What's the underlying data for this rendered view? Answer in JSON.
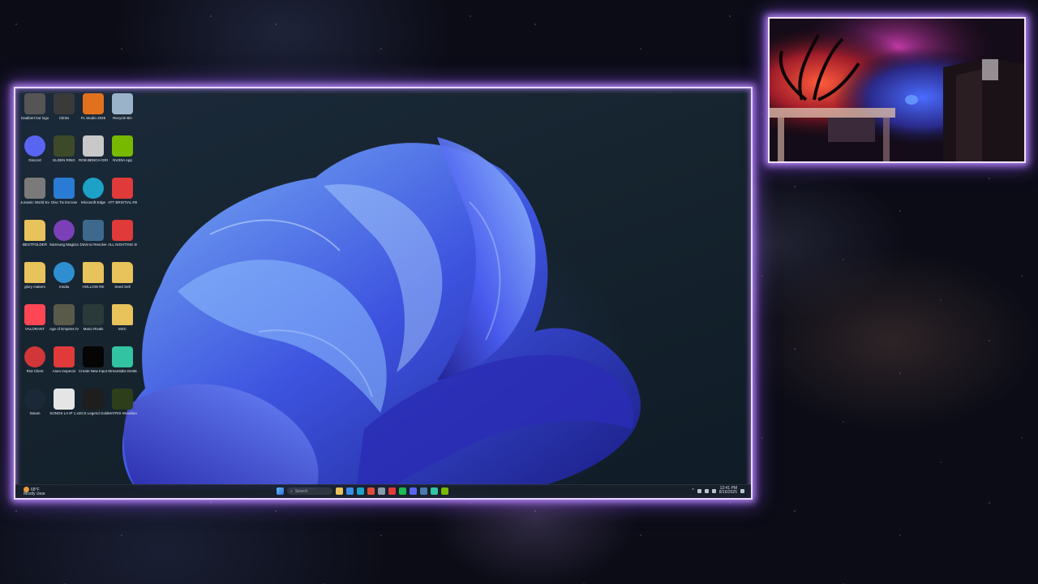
{
  "desktop": {
    "icons": [
      {
        "label": "Gaalbert bot logo",
        "icon": "image-file-icon",
        "color": "#555"
      },
      {
        "label": "Clinks",
        "icon": "app-icon",
        "color": "#3a3a3a"
      },
      {
        "label": "FL Studio 2025",
        "icon": "fl-studio-icon",
        "color": "#e2711d"
      },
      {
        "label": "Recycle Bin",
        "icon": "recycle-bin-icon",
        "color": "#9bb3c9"
      },
      {
        "label": "Discord",
        "icon": "discord-icon",
        "color": "#5865f2"
      },
      {
        "label": "ELDEN RING",
        "icon": "elden-ring-icon",
        "color": "#3d4a2a"
      },
      {
        "label": "RGB BENCH GRID SHEET",
        "icon": "document-icon",
        "color": "#c8c8c8"
      },
      {
        "label": "NVIDIA App",
        "icon": "nvidia-icon",
        "color": "#76b900"
      },
      {
        "label": "Jurassic World Evolution",
        "icon": "jurassic-icon",
        "color": "#7a7a7a"
      },
      {
        "label": "Disc Tix Escrow",
        "icon": "disc-icon",
        "color": "#2a7bd4"
      },
      {
        "label": "Microsoft Edge",
        "icon": "edge-icon",
        "color": "#1da1c7"
      },
      {
        "label": "ATT BRISTIAL RE SHEED",
        "icon": "pdf-icon",
        "color": "#e03a3a"
      },
      {
        "label": "BESTFOLDER",
        "icon": "folder-icon",
        "color": "#e8c25a"
      },
      {
        "label": "Samsung Magician",
        "icon": "samsung-magician-icon",
        "color": "#7b3fb7"
      },
      {
        "label": "DaVinci Resolve",
        "icon": "davinci-icon",
        "color": "#3d6a8c"
      },
      {
        "label": "ALL NIGHTING Street Squared",
        "icon": "pdf-icon",
        "color": "#e03a3a"
      },
      {
        "label": "glory makers",
        "icon": "folder-icon",
        "color": "#e8c25a"
      },
      {
        "label": "media",
        "icon": "media-player-icon",
        "color": "#2e8fd0"
      },
      {
        "label": "HOLLOW RE",
        "icon": "folder-icon",
        "color": "#e8c25a"
      },
      {
        "label": "Seed Sell",
        "icon": "folder-icon",
        "color": "#e8c25a"
      },
      {
        "label": "VALORANT",
        "icon": "valorant-icon",
        "color": "#ff4655"
      },
      {
        "label": "Age of Empires IV Anniversary Edition",
        "icon": "aoe-icon",
        "color": "#5a5a4a"
      },
      {
        "label": "Mario Rivals",
        "icon": "game-icon",
        "color": "#2a3a3a"
      },
      {
        "label": "MSC",
        "icon": "folder-icon",
        "color": "#e8c25a"
      },
      {
        "label": "Riot Client",
        "icon": "riot-client-icon",
        "color": "#d13639"
      },
      {
        "label": "Aseo Inspecto",
        "icon": "acrobat-icon",
        "color": "#e03a3a"
      },
      {
        "label": "Create New Input (1)",
        "icon": "black-app-icon",
        "color": "#050505"
      },
      {
        "label": "Streamlabs Desktop",
        "icon": "streamlabs-icon",
        "color": "#31c3a2"
      },
      {
        "label": "Steam",
        "icon": "steam-icon",
        "color": "#1b2838"
      },
      {
        "label": "SONOS LA IP 1.x",
        "icon": "document-icon",
        "color": "#e5e5e5"
      },
      {
        "label": "DCS Legend Gold",
        "icon": "dcs-icon",
        "color": "#1e1e1e"
      },
      {
        "label": "MATRIX Woodtool",
        "icon": "matrix-icon",
        "color": "#2c3e1a"
      }
    ]
  },
  "taskbar": {
    "weather_temp": "68°F",
    "weather_desc": "Mostly clear",
    "search_placeholder": "Search",
    "clock_time": "12:41 PM",
    "clock_date": "8/16/2025",
    "pinned": [
      "file-explorer-icon",
      "store-icon",
      "edge-icon",
      "chrome-icon",
      "settings-icon",
      "opera-icon",
      "spotify-icon",
      "discord-icon",
      "steam-icon",
      "streamlabs-icon",
      "nvidia-icon"
    ],
    "pinned_colors": [
      "#e8c25a",
      "#3a8ee6",
      "#1da1c7",
      "#e04a3a",
      "#8a9aaa",
      "#e03a3a",
      "#1db954",
      "#5865f2",
      "#4a7ab0",
      "#31c3a2",
      "#76b900"
    ]
  }
}
